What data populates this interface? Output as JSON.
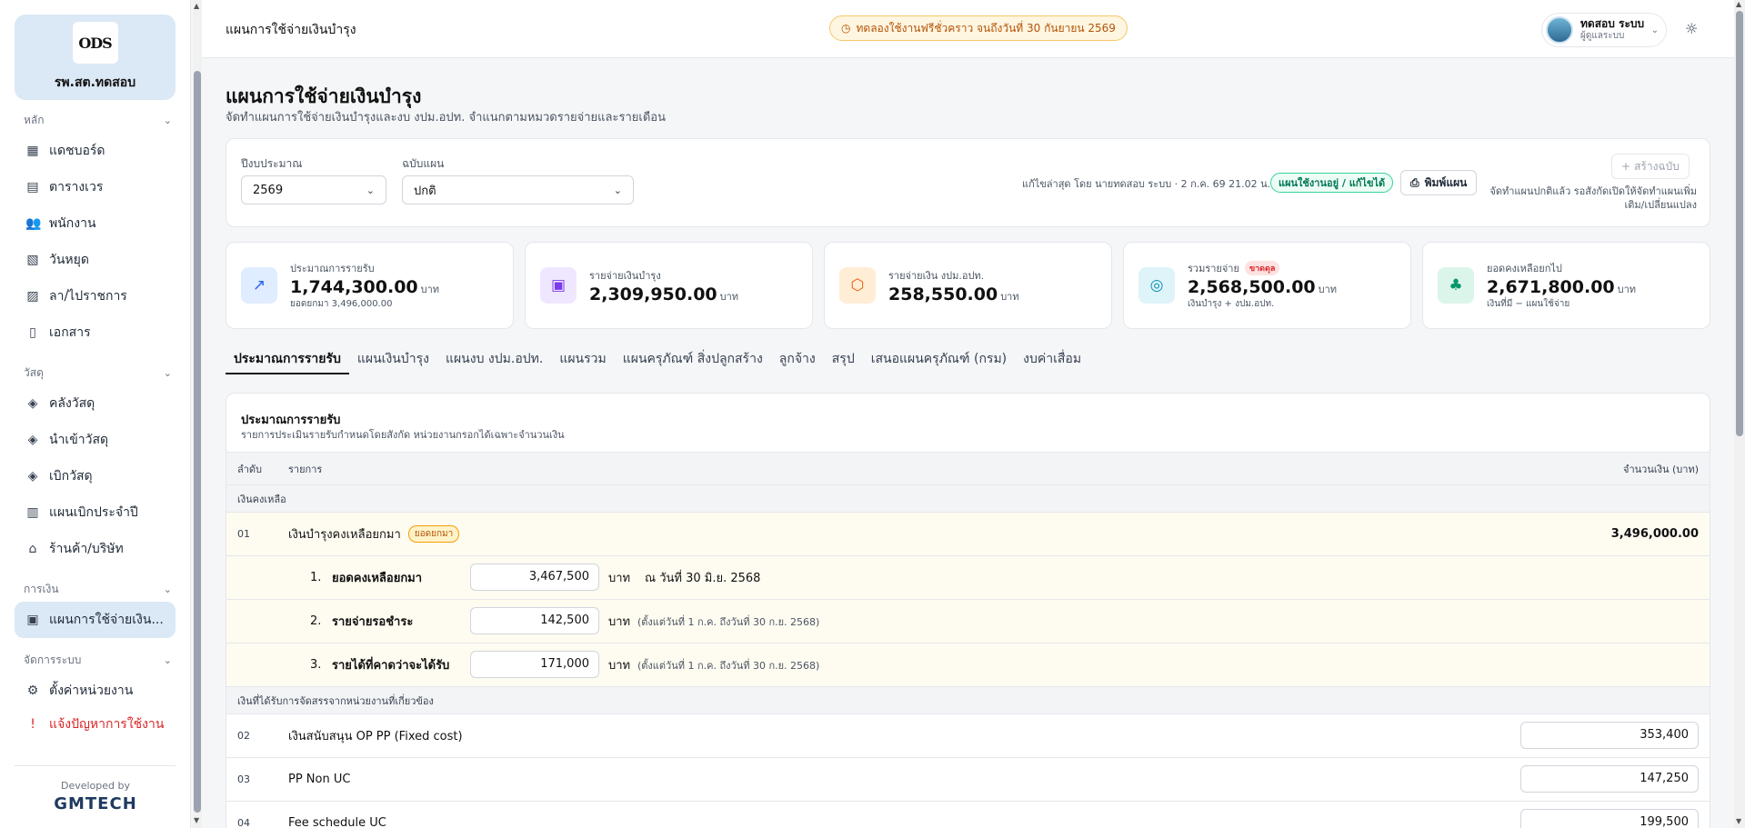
{
  "sidebar": {
    "logo_text": "ODS",
    "org_name": "รพ.สต.ทดสอบ",
    "sections": {
      "main": "หลัก",
      "supplies": "วัสดุ",
      "finance": "การเงิน",
      "system": "จัดการระบบ"
    },
    "items": {
      "dashboard": "แดชบอร์ด",
      "schedule": "ตารางเวร",
      "staff": "พนักงาน",
      "holidays": "วันหยุด",
      "leave": "ลา/ไปราชการ",
      "documents": "เอกสาร",
      "warehouse": "คลังวัสดุ",
      "import": "นำเข้าวัสดุ",
      "withdraw": "เบิกวัสดุ",
      "annual_plan": "แผนเบิกประจำปี",
      "vendors": "ร้านค้า/บริษัท",
      "spending_plan": "แผนการใช้จ่ายเงิน...",
      "unit_settings": "ตั้งค่าหน่วยงาน",
      "report_issue": "แจ้งปัญหาการใช้งาน"
    },
    "developed_by": "Developed by",
    "developer": "GMTECH"
  },
  "header": {
    "page_title": "แผนการใช้จ่ายเงินบำรุง",
    "trial_notice": "ทดลองใช้งานฟรีชั่วคราว จนถึงวันที่ 30 กันยายน 2569",
    "user_name": "ทดสอบ ระบบ",
    "user_role": "ผู้ดูแลระบบ"
  },
  "page": {
    "title": "แผนการใช้จ่ายเงินบำรุง",
    "subtitle": "จัดทำแผนการใช้จ่ายเงินบำรุงและงบ งปม.อปท. จำแนกตามหมวดรายจ่ายและรายเดือน"
  },
  "filters": {
    "year_label": "ปีงบประมาณ",
    "year_value": "2569",
    "version_label": "ฉบับแผน",
    "version_value": "ปกติ",
    "last_edit": "แก้ไขล่าสุด โดย นายทดสอบ ระบบ · 2 ก.ค. 69 21.02 น.",
    "status": "แผนใช้งานอยู่ / แก้ไขได้",
    "print_label": "พิมพ์แผน",
    "new_version_label": "สร้างฉบับ",
    "note": "จัดทำแผนปกติแล้ว รอสังกัดเปิดให้จัดทำแผนเพิ่มเติม/เปลี่ยนแปลง"
  },
  "stats": [
    {
      "label": "ประมาณการรายรับ",
      "value": "1,744,300.00",
      "unit": "บาท",
      "note": "ยอดยกมา 3,496,000.00",
      "icon": "trend-up-icon",
      "color": "#2563eb",
      "bg": "#e0ecff"
    },
    {
      "label": "รายจ่ายเงินบำรุง",
      "value": "2,309,950.00",
      "unit": "บาท",
      "note": "",
      "icon": "wallet-icon",
      "color": "#7c3aed",
      "bg": "#efe7ff"
    },
    {
      "label": "รายจ่ายเงิน งปม.อปท.",
      "value": "258,550.00",
      "unit": "บาท",
      "note": "",
      "icon": "box-icon",
      "color": "#ea580c",
      "bg": "#ffedd5"
    },
    {
      "label": "รวมรายจ่าย",
      "value": "2,568,500.00",
      "unit": "บาท",
      "note": "เงินบำรุง + งปม.อปท.",
      "badge": "ขาดดุล",
      "icon": "coins-icon",
      "color": "#0891b2",
      "bg": "#dff4f9"
    },
    {
      "label": "ยอดคงเหลือยกไป",
      "value": "2,671,800.00",
      "unit": "บาท",
      "note": "เงินที่มี − แผนใช้จ่าย",
      "icon": "piggy-bank-icon",
      "color": "#059669",
      "bg": "#dcf5ea"
    }
  ],
  "tabs": [
    "ประมาณการรายรับ",
    "แผนเงินบำรุง",
    "แผนงบ งปม.อปท.",
    "แผนรวม",
    "แผนครุภัณฑ์ สิ่งปลูกสร้าง",
    "ลูกจ้าง",
    "สรุป",
    "เสนอแผนครุภัณฑ์ (กรม)",
    "งบค่าเสื่อม"
  ],
  "table": {
    "title": "ประมาณการรายรับ",
    "subtitle": "รายการประเมินรายรับกำหนดโดยสังกัด หน่วยงานกรอกได้เฉพาะจำนวนเงิน",
    "col_no": "ลำดับ",
    "col_item": "รายการ",
    "col_amount": "จำนวนเงิน (บาท)",
    "group1": "เงินคงเหลือ",
    "row01": {
      "no": "01",
      "label": "เงินบำรุงคงเหลือยกมา",
      "badge": "ยอดยกมา",
      "amount": "3,496,000.00"
    },
    "sub": [
      {
        "idx": "1.",
        "label": "ยอดคงเหลือยกมา",
        "value": "3,467,500",
        "unit": "บาท",
        "asof": "ณ วันที่  30 มิ.ย. 2568",
        "note": ""
      },
      {
        "idx": "2.",
        "label": "รายจ่ายรอชำระ",
        "value": "142,500",
        "unit": "บาท",
        "asof": "",
        "note": "(ตั้งแต่วันที่ 1 ก.ค. ถึงวันที่ 30 ก.ย. 2568)"
      },
      {
        "idx": "3.",
        "label": "รายได้ที่คาดว่าจะได้รับ",
        "value": "171,000",
        "unit": "บาท",
        "asof": "",
        "note": "(ตั้งแต่วันที่ 1 ก.ค. ถึงวันที่ 30 ก.ย. 2568)"
      }
    ],
    "group2": "เงินที่ได้รับการจัดสรรจากหน่วยงานที่เกี่ยวข้อง",
    "rows": [
      {
        "no": "02",
        "label": "เงินสนับสนุน OP PP (Fixed cost)",
        "value": "353,400"
      },
      {
        "no": "03",
        "label": "PP Non UC",
        "value": "147,250"
      },
      {
        "no": "04",
        "label": "Fee schedule UC",
        "value": "199,500"
      }
    ]
  }
}
